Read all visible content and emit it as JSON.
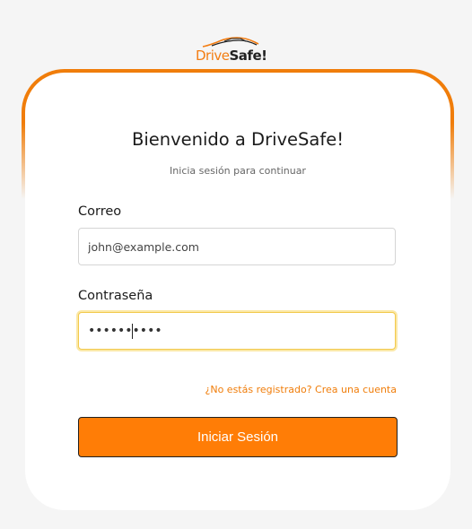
{
  "logo": {
    "part1": "Drive",
    "part2": "Safe!",
    "icon": "car-outline-icon",
    "color_primary": "#f37d12",
    "color_secondary": "#222222"
  },
  "header": {
    "title": "Bienvenido a DriveSafe!",
    "subtitle": "Inicia sesión para continuar"
  },
  "form": {
    "email_label": "Correo",
    "email_value": "john@example.com",
    "password_label": "Contraseña",
    "password_value": "••••••••••",
    "signup_link": "¿No estás registrado? Crea una cuenta",
    "submit_label": "Iniciar Sesión"
  },
  "colors": {
    "accent": "#ff7d06",
    "frame": "#f07d0a",
    "focus_border": "#f2c94c",
    "background": "#f5f5f5"
  }
}
